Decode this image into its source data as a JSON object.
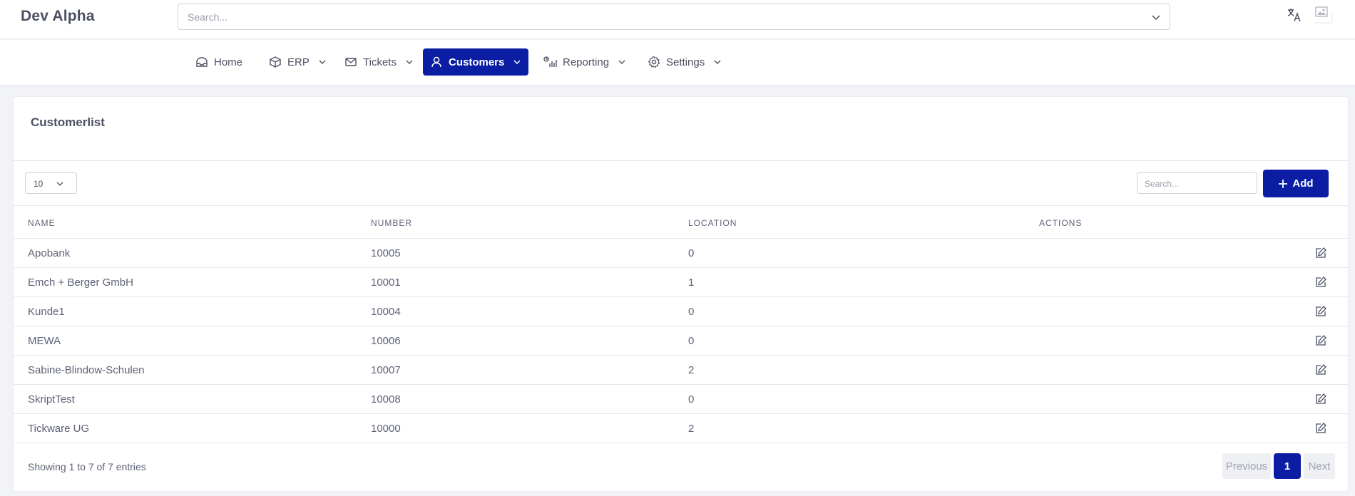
{
  "app": {
    "title": "Dev Alpha"
  },
  "header": {
    "search_placeholder": "Search..."
  },
  "nav": {
    "items": [
      {
        "label": "Home",
        "icon": "home-icon"
      },
      {
        "label": "ERP",
        "icon": "box-icon"
      },
      {
        "label": "Tickets",
        "icon": "envelope-icon"
      },
      {
        "label": "Customers",
        "icon": "user-icon",
        "active": true
      },
      {
        "label": "Reporting",
        "icon": "chart-icon"
      },
      {
        "label": "Settings",
        "icon": "gear-icon"
      }
    ]
  },
  "card": {
    "title": "Customerlist",
    "page_size": "10",
    "search_placeholder": "Search...",
    "add_label": "Add"
  },
  "table": {
    "columns": [
      "NAME",
      "NUMBER",
      "LOCATION",
      "ACTIONS"
    ],
    "rows": [
      {
        "name": "Apobank",
        "number": "10005",
        "location": "0"
      },
      {
        "name": "Emch + Berger GmbH",
        "number": "10001",
        "location": "1"
      },
      {
        "name": "Kunde1",
        "number": "10004",
        "location": "0"
      },
      {
        "name": "MEWA",
        "number": "10006",
        "location": "0"
      },
      {
        "name": "Sabine-Blindow-Schulen",
        "number": "10007",
        "location": "2"
      },
      {
        "name": "SkriptTest",
        "number": "10008",
        "location": "0"
      },
      {
        "name": "Tickware UG",
        "number": "10000",
        "location": "2"
      }
    ]
  },
  "footer": {
    "entries_info": "Showing 1 to 7 of 7 entries",
    "prev_label": "Previous",
    "current_page": "1",
    "next_label": "Next"
  },
  "colors": {
    "accent": "#0b1ea3",
    "background": "#f2f3f7"
  }
}
